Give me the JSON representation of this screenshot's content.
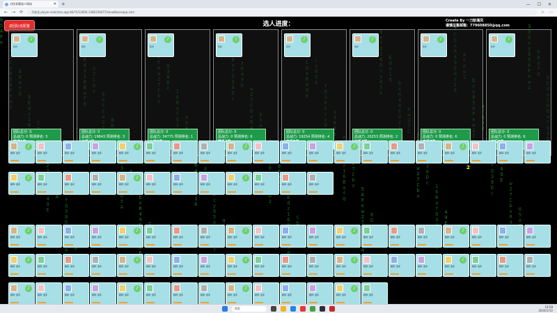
{
  "browser": {
    "tab_title": "刀饮非赛选人网站",
    "url": "不安全  player-selection.app:46/?5/12856-1386158477/showBasesapp.com",
    "controls": {
      "back": "←",
      "forward": "→",
      "reload": "⟳",
      "new_tab": "+",
      "minimize": "—",
      "maximize": "☐",
      "close": "✕"
    }
  },
  "game": {
    "back_button": "返回队伍配置",
    "title": "选人进度：",
    "credit_line1": "Create By 一刀斩满风",
    "credit_line2": "谨慎征集邮箱：779608850@qq.com",
    "teams": [
      {
        "captain": "队长",
        "stats1": "团队总分: 0",
        "stats2": "总战力: 0 预测排名: 5",
        "stats3": "普通1号",
        "stats_extra": "value: 0 | 4人"
      },
      {
        "captain": "队长",
        "stats1": "团队总分: 0",
        "stats2": "总战力: 19843 预测排名: 3",
        "stats3": "水系2号",
        "stats_extra": "value: 35 | 4人"
      },
      {
        "captain": "队长",
        "stats1": "团队总分: 0",
        "stats2": "总战力: 34775 预测排名: 1",
        "stats3": "火系3号",
        "stats_extra": "value: 8 | 4人"
      },
      {
        "captain": "队长",
        "stats1": "团队总分: 0",
        "stats2": "总战力: 0 预测排名: 6",
        "stats3": "草系4号",
        "stats_extra": "value: 86 | 4人"
      },
      {
        "captain": "队长",
        "stats1": "团队总分: 0",
        "stats2": "总战力: 19254 预测排名: 4",
        "stats3": "电系5号",
        "stats_extra": "value: 17 | 4人"
      },
      {
        "captain": "队长",
        "stats1": "团队总分: 0",
        "stats2": "总战力: 20253 预测排名: 2",
        "stats3": "冰系6号",
        "stats_extra": "value: 37 | 4人"
      },
      {
        "captain": "队长",
        "stats1": "团队总分: 0",
        "stats2": "总战力: 0 预测排名: 6",
        "stats3": "虫系7号",
        "stats_extra": "value: 42 | 4人"
      },
      {
        "captain": "队长",
        "stats1": "团队总分: 0",
        "stats2": "总战力: 0 预测排名: 6",
        "stats3": "飞行8号",
        "stats_extra": "value: 42 | 4人"
      }
    ],
    "player_text": "昵称: 选手",
    "number_label": "2"
  },
  "taskbar": {
    "search": "搜索",
    "time": "19:58",
    "date": "2024/1/12"
  }
}
